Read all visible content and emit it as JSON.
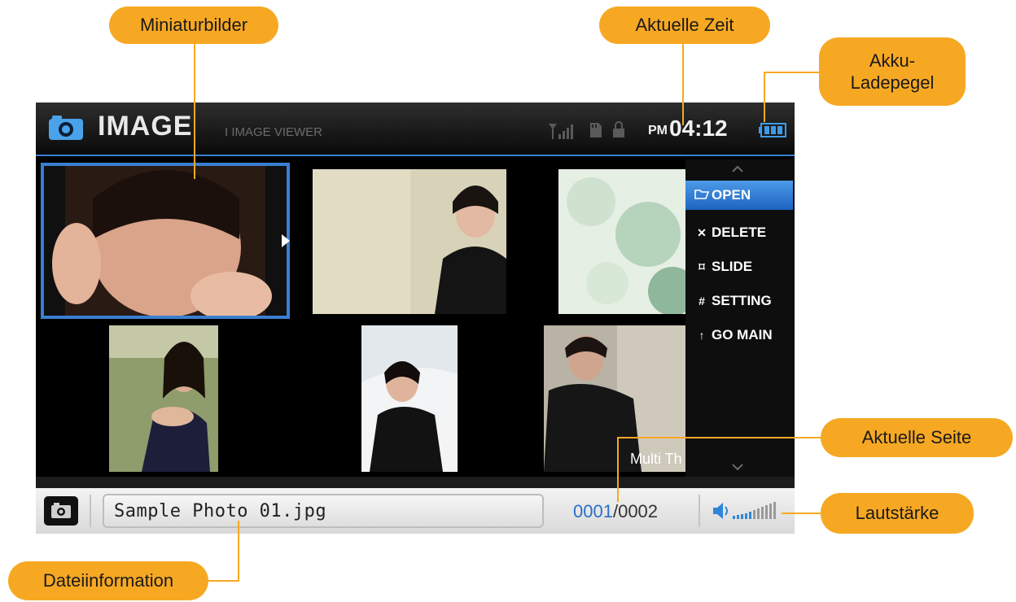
{
  "callouts": {
    "miniaturbilder": "Miniaturbilder",
    "aktuelle_zeit": "Aktuelle Zeit",
    "akku_line1": "Akku-",
    "akku_line2": "Ladepegel",
    "aktuelle_seite": "Aktuelle Seite",
    "lautstaerke": "Lautstärke",
    "dateiinformation": "Dateiinformation"
  },
  "header": {
    "app_title": "IMAGE",
    "subtitle": "I IMAGE VIEWER",
    "time_ampm": "PM",
    "time": "04:12"
  },
  "menu": {
    "items": [
      {
        "icon": "folder-open-icon",
        "glyph": "▭",
        "label": "OPEN",
        "active": true
      },
      {
        "icon": "delete-icon",
        "glyph": "✕",
        "label": "DELETE",
        "active": false
      },
      {
        "icon": "slideshow-icon",
        "glyph": "⌑",
        "label": "SLIDE",
        "active": false
      },
      {
        "icon": "settings-icon",
        "glyph": "#",
        "label": "SETTING",
        "active": false
      },
      {
        "icon": "go-main-icon",
        "glyph": "↑",
        "label": "GO MAIN",
        "active": false
      }
    ]
  },
  "thumbnail_caption": "Multi Th",
  "footer": {
    "filename": "Sample Photo 01.jpg",
    "page_current": "0001",
    "page_sep": "/",
    "page_total": "0002"
  },
  "colors": {
    "callout": "#f7a823",
    "selection": "#3a7fd0",
    "page_current": "#2a6fc9"
  }
}
